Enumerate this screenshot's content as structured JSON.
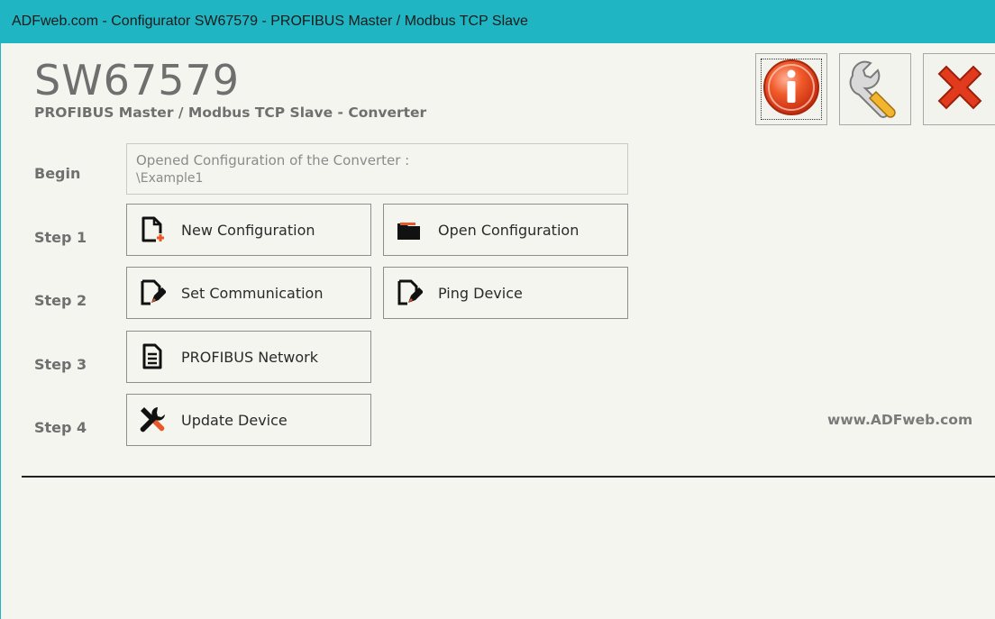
{
  "window": {
    "title": "ADFweb.com - Configurator SW67579 -  PROFIBUS Master /  Modbus TCP Slave"
  },
  "header": {
    "product_code": "SW67579",
    "subtitle": "PROFIBUS Master / Modbus TCP Slave - Converter"
  },
  "toolbar": {
    "info_icon": "info-icon",
    "settings_icon": "wrench-icon",
    "exit_icon": "close-icon"
  },
  "steps": {
    "begin_label": "Begin",
    "step1_label": "Step 1",
    "step2_label": "Step 2",
    "step3_label": "Step 3",
    "step4_label": "Step 4"
  },
  "status": {
    "line1": "Opened Configuration of the Converter :",
    "line2": "\\Example1"
  },
  "buttons": {
    "new_configuration": "New Configuration",
    "open_configuration": "Open Configuration",
    "set_communication": "Set Communication",
    "ping_device": "Ping Device",
    "profibus_network": "PROFIBUS Network",
    "update_device": "Update Device"
  },
  "footer": {
    "website": "www.ADFweb.com"
  },
  "colors": {
    "titlebar": "#1fb5c2",
    "accent": "#e8562a"
  }
}
